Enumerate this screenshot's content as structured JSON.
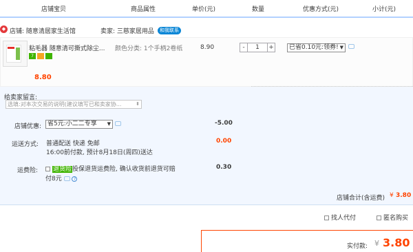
{
  "header": {
    "col_shop_item": "店铺宝贝",
    "col_props": "商品属性",
    "col_price": "单价(元)",
    "col_qty": "数量",
    "col_discount": "优惠方式(元)",
    "col_subtotal": "小计(元)"
  },
  "shop": {
    "label": "店铺: 随意清居家生活馆",
    "seller": "卖家: 三慈家居用品",
    "contact": "和我联系"
  },
  "item": {
    "title": "粘毛器 随意清可撕式除尘...",
    "props": "颜色分类: 1个手柄2卷纸",
    "unit_price": "8.90",
    "quantity": "1",
    "qty_minus": "-",
    "qty_plus": "+",
    "discount_select": "已省0.10元:领券!",
    "subtotal": "8.80",
    "badges": [
      "7",
      "",
      ""
    ]
  },
  "message": {
    "label": "给卖家留言:",
    "placeholder": "选填:对本次交易的说明(建议填写已和卖家协..."
  },
  "shop_discount": {
    "label": "店铺优惠:",
    "select": "省5元:小二二专享",
    "amount": "-5.00"
  },
  "shipping": {
    "label": "运送方式:",
    "line1": "普通配送 快递 免邮",
    "line2": "16:00前付款, 预计8月18日(周四)送达",
    "amount": "0.00"
  },
  "insurance": {
    "label": "运费险:",
    "highlight": "退货险",
    "text1": "投保退货运费险, 确认收货前退货可赔",
    "text2": "付8元",
    "amount": "0.30"
  },
  "total": {
    "label": "店铺合计(含运费)",
    "currency": "¥",
    "value": "3.80"
  },
  "options": {
    "proxy_pay": "找人代付",
    "anonymous": "匿名购买"
  },
  "actual_pay": {
    "label": "实付款:",
    "currency": "¥",
    "value": "3.80"
  },
  "colors": {
    "accent": "#ff4400",
    "header_border": "#b2d1ff",
    "panel_bg": "#f2f7ff",
    "link_blue": "#0a86d6"
  }
}
